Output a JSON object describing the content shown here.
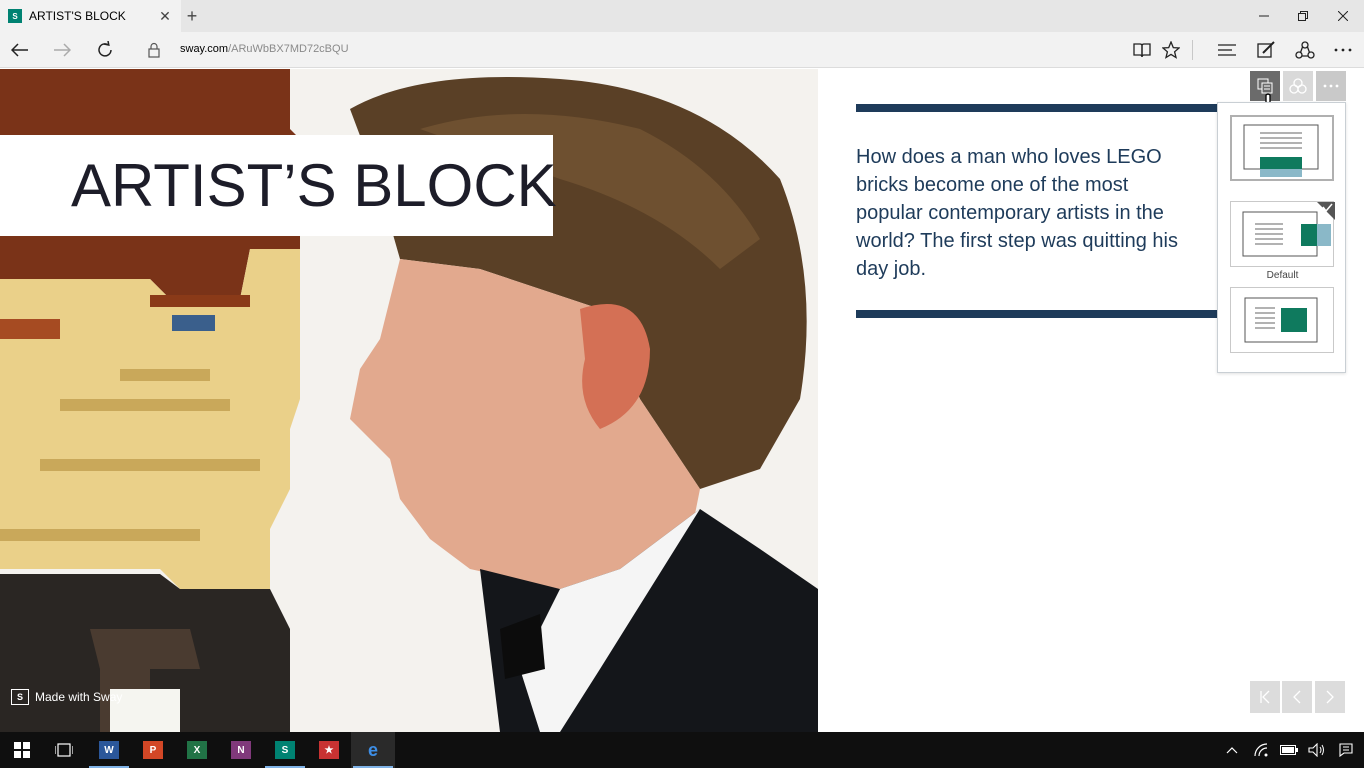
{
  "browser": {
    "tab_title": "ARTIST'S BLOCK",
    "tab_close": "✕",
    "new_tab": "+",
    "url_host": "sway.com",
    "url_path": "/ARuWbBX7MD72cBQU",
    "window_controls": [
      "minimize-icon",
      "restore-icon",
      "close-icon"
    ],
    "nav_icons": [
      "back-arrow-icon",
      "forward-arrow-icon",
      "refresh-icon"
    ],
    "toolbar_icons": [
      "reading-view-icon",
      "favorite-star-icon",
      "hub-icon",
      "web-note-icon",
      "share-icon",
      "more-icon"
    ]
  },
  "sway": {
    "title": "ARTIST’S BLOCK",
    "intro": "How does a man who loves LEGO\nbricks become one of the most\npopular contemporary artists in the\nworld? The first step was quitting his\nday job.",
    "made_with": "Made with Sway",
    "made_icon": "S",
    "design_buttons": [
      "layout-icon",
      "theme-icon",
      "more-icon"
    ],
    "layout_panel": {
      "default_label": "Default",
      "options": [
        "layout-option-stacked",
        "layout-option-default",
        "layout-option-inset"
      ],
      "selected": "layout-option-default"
    },
    "page_nav": [
      "first-page-icon",
      "previous-page-icon",
      "next-page-icon"
    ],
    "colors": {
      "accent": "#1e3b5a",
      "sway_green": "#008272",
      "title": "#1d1d29"
    }
  },
  "taskbar": {
    "apps": [
      {
        "name": "start-icon"
      },
      {
        "name": "task-view-icon"
      },
      {
        "name": "word-icon",
        "letter": "W",
        "color": "#2b579a"
      },
      {
        "name": "powerpoint-icon",
        "letter": "P",
        "color": "#d24726"
      },
      {
        "name": "excel-icon",
        "letter": "X",
        "color": "#217346"
      },
      {
        "name": "onenote-icon",
        "letter": "N",
        "color": "#80397b"
      },
      {
        "name": "sway-icon",
        "letter": "S",
        "color": "#008272"
      },
      {
        "name": "pinned-app-icon",
        "letter": "★",
        "color": "#c83232"
      },
      {
        "name": "edge-icon",
        "letter": "e",
        "color": "#1a6fc9"
      }
    ],
    "tray": [
      "chevron-up-icon",
      "wifi-icon",
      "battery-icon",
      "volume-icon",
      "action-center-icon"
    ]
  }
}
